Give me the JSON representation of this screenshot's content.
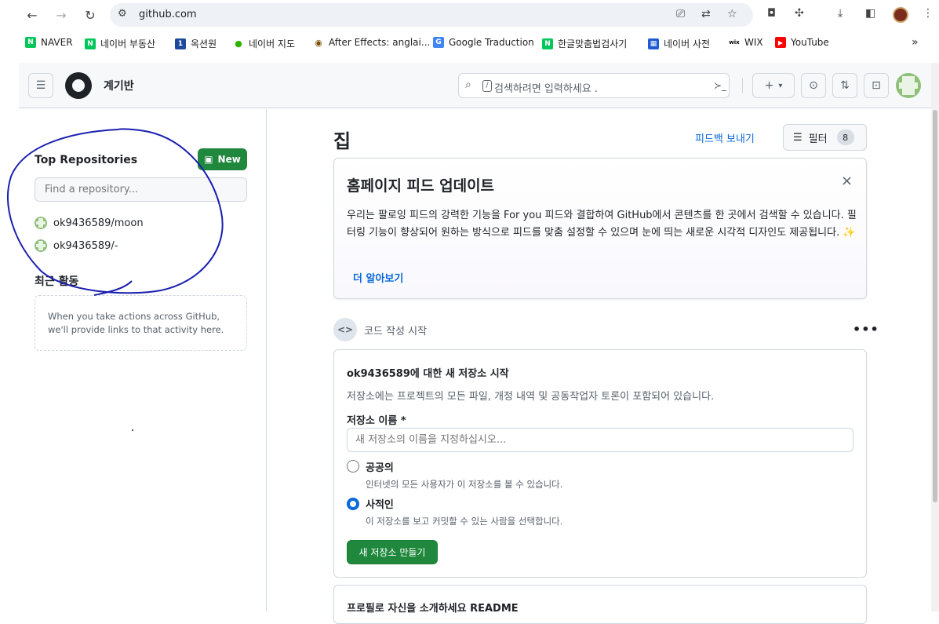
{
  "browser": {
    "url": "github.com",
    "bookmarks": [
      {
        "label": "NAVER",
        "icon": "naver-icon",
        "color": "#03c75a"
      },
      {
        "label": "네이버 부동산",
        "icon": "naver-icon",
        "color": "#03c75a"
      },
      {
        "label": "옥션원",
        "icon": "auction-icon",
        "color": "#1d4a9a"
      },
      {
        "label": "네이버 지도",
        "icon": "map-pin-icon",
        "color": "#2db400"
      },
      {
        "label": "After Effects: anglai...",
        "icon": "ae-icon",
        "color": "#7a4b00"
      },
      {
        "label": "Google Traduction",
        "icon": "translate-icon",
        "color": "#4285f4"
      },
      {
        "label": "한글맞춤법검사기",
        "icon": "naver-icon",
        "color": "#03c75a"
      },
      {
        "label": "네이버 사전",
        "icon": "dictionary-icon",
        "color": "#1e5bd3"
      },
      {
        "label": "WIX",
        "icon": "wix-icon",
        "color": "#000000"
      },
      {
        "label": "YouTube",
        "icon": "youtube-icon",
        "color": "#ff0000"
      }
    ],
    "more_label": "»"
  },
  "header": {
    "title": "계기반",
    "search_placeholder": "검색하려면 입력하세요 .",
    "slash_key": "/",
    "plus_label": "+",
    "caret": "▾"
  },
  "sidebar": {
    "top_repos_title": "Top Repositories",
    "new_button": "New",
    "find_placeholder": "Find a repository...",
    "repos": [
      "ok9436589/moon",
      "ok9436589/-"
    ],
    "recent_title": "최근 활동",
    "recent_empty": "When you take actions across GitHub, we'll provide links to that activity here."
  },
  "main": {
    "title": "집",
    "feedback_link": "피드백 보내기",
    "filter_label": "필터",
    "filter_count": "8",
    "update_card": {
      "title": "홈페이지 피드 업데이트",
      "body": "우리는 팔로잉 피드의 강력한 기능을 For you 피드와 결합하여 GitHub에서 콘텐츠를 한 곳에서 검색할 수 있습니다. 필터링 기능이 향상되어 원하는 방식으로 피드를 맞춤 설정할 수 있으며 눈에 띄는 새로운 시각적 디자인도 제공됩니다.",
      "sparkle": "✨",
      "learn_more": "더 알아보기",
      "close": "×"
    },
    "code_start": {
      "label": "코드 작성 시작",
      "icon_text": "<>",
      "kebab": "•••"
    },
    "create_repo": {
      "title": "ok9436589에 대한 새 저장소 시작",
      "subtitle": "저장소에는 프로젝트의 모든 파일, 개정 내역 및 공동작업자 토론이 포함되어 있습니다.",
      "name_label": "저장소 이름 *",
      "name_placeholder": "새 저장소의 이름을 지정하십시오...",
      "public_label": "공공의",
      "public_desc": "인터넷의 모든 사용자가 이 저장소를 볼 수 있습니다.",
      "private_label": "사적인",
      "private_desc": "이 저장소를 보고 커밋할 수 있는 사람을 선택합니다.",
      "selected": "private",
      "button": "새 저장소 만들기"
    },
    "readme_title": "프로필로 자신을 소개하세요 README"
  },
  "colors": {
    "accent": "#0969da",
    "green": "#1f883d",
    "annotation": "#1a1fb0"
  }
}
